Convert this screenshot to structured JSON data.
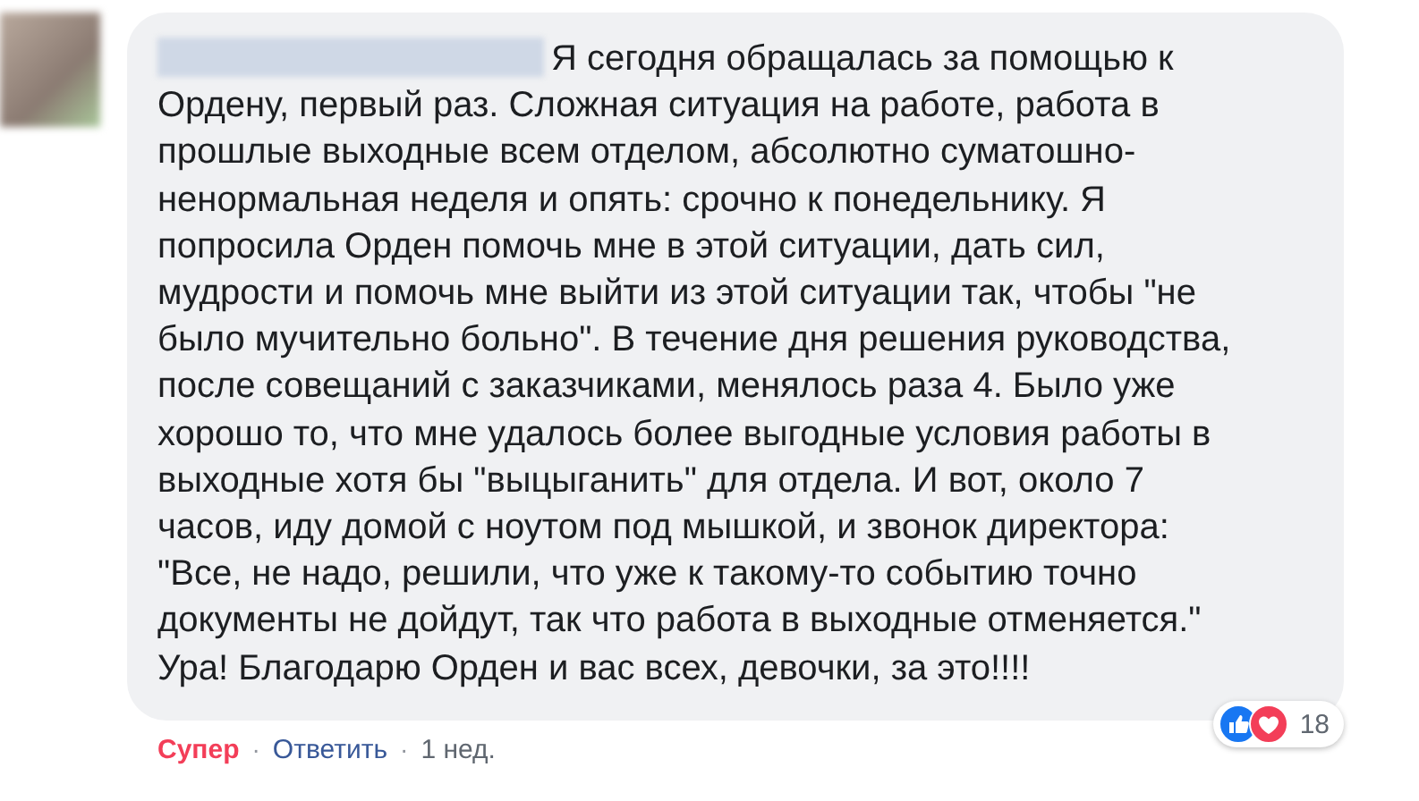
{
  "comment": {
    "lines": [
      "Я сегодня обращалась за помощью к",
      "Ордену, первый раз. Сложная ситуация на работе, работа в",
      "прошлые выходные всем отделом, абсолютно суматошно-",
      "ненормальная неделя и опять: срочно к понедельнику. Я",
      "попросила Орден помочь мне в этой ситуации, дать сил,",
      "мудрости и помочь мне выйти из этой ситуации так, чтобы \"не",
      "было мучительно больно\". В течение дня решения руководства,",
      "после совещаний с заказчиками, менялось раза 4. Было уже",
      "хорошо то, что мне удалось более выгодные условия работы в",
      "выходные хотя бы \"выцыганить\" для отдела. И вот, около 7",
      "часов, иду домой с ноутом под мышкой, и звонок директора:",
      "\"Все, не надо, решили, что уже к такому-то событию точно",
      "документы не дойдут, так что работа в выходные отменяется.\"",
      "Ура! Благодарю Орден и вас всех, девочки, за это!!!!"
    ],
    "reactions": {
      "icons": [
        {
          "kind": "like"
        },
        {
          "kind": "love"
        }
      ],
      "count": "18"
    }
  },
  "separator": "·",
  "actions": [
    {
      "kind": "reaction",
      "label": "Супер"
    },
    {
      "kind": "link",
      "label": "Ответить"
    },
    {
      "kind": "time",
      "label": "1 нед."
    }
  ]
}
